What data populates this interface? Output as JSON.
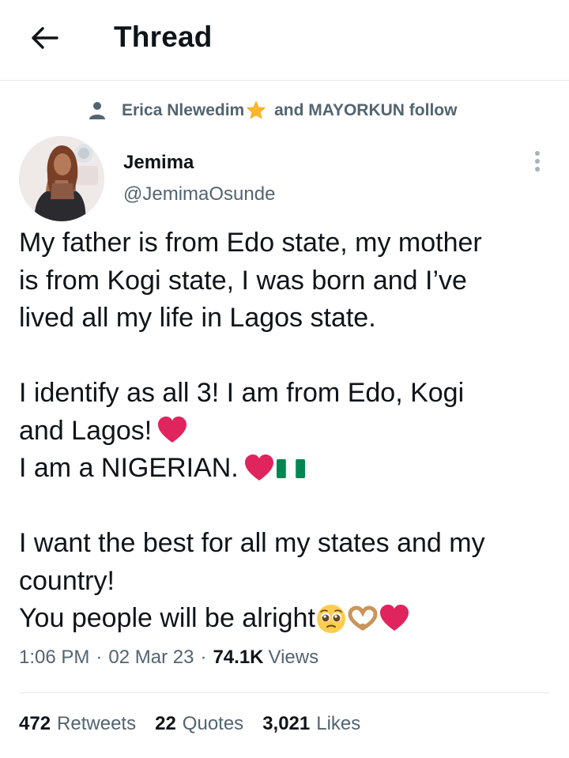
{
  "header": {
    "title": "Thread",
    "back_icon": "arrow-left-icon"
  },
  "social_context": {
    "first_name": "Erica Nlewedim",
    "second_part": " and MAYORKUN follow",
    "icon": "person-icon",
    "badge_icon": "star-emoji"
  },
  "author": {
    "name": "Jemima",
    "handle": "@JemimaOsunde",
    "avatar_icon": "profile-photo"
  },
  "tweet": {
    "lines": [
      "My father is from Edo state, my mother",
      "is from Kogi state, I was born and I’ve",
      "lived all my life in Lagos state.",
      "",
      "I identify as all 3! I am from Edo, Kogi",
      "and Lagos!",
      "I am a NIGERIAN.",
      "",
      "I want the best for all my states and my",
      "country!",
      "You people will be alright"
    ],
    "emojis": {
      "line6": [
        "red-heart-emoji"
      ],
      "line7": [
        "red-heart-emoji",
        "nigeria-flag-emoji"
      ],
      "line11": [
        "pleading-face-emoji",
        "heart-hands-emoji",
        "red-heart-emoji"
      ]
    }
  },
  "meta": {
    "time": "1:06 PM",
    "separator": "·",
    "date": "02 Mar 23",
    "views_count": "74.1K",
    "views_label": "Views"
  },
  "stats": {
    "retweets_count": "472",
    "retweets_label": "Retweets",
    "quotes_count": "22",
    "quotes_label": "Quotes",
    "likes_count": "3,021",
    "likes_label": "Likes"
  },
  "colors": {
    "text_primary": "#0f1419",
    "text_secondary": "#536471",
    "divider": "#e6e9ec",
    "heart": "#e0245e",
    "nigeria_green": "#008751"
  }
}
